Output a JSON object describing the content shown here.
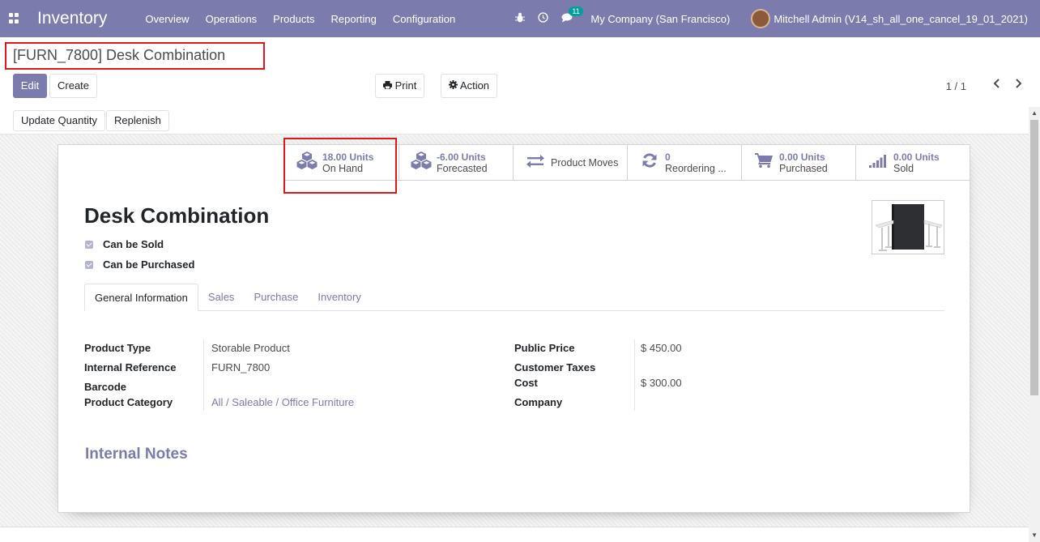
{
  "navbar": {
    "brand": "Inventory",
    "menu": [
      "Overview",
      "Operations",
      "Products",
      "Reporting",
      "Configuration"
    ],
    "chat_count": "11",
    "company": "My Company (San Francisco)",
    "user": "Mitchell Admin (V14_sh_all_one_cancel_19_01_2021)"
  },
  "control_panel": {
    "breadcrumb": "[FURN_7800] Desk Combination",
    "edit_label": "Edit",
    "create_label": "Create",
    "print_label": "Print",
    "action_label": "Action",
    "pager": "1 / 1"
  },
  "statusbar": {
    "update_quantity_label": "Update Quantity",
    "replenish_label": "Replenish"
  },
  "smart_buttons": {
    "on_hand": {
      "value": "18.00 Units",
      "label": "On Hand"
    },
    "forecasted": {
      "value": "-6.00 Units",
      "label": "Forecasted"
    },
    "product_moves": {
      "label": "Product Moves"
    },
    "reordering": {
      "value": "0",
      "label": "Reordering ..."
    },
    "purchased": {
      "value": "0.00 Units",
      "label": "Purchased"
    },
    "sold": {
      "value": "0.00 Units",
      "label": "Sold"
    }
  },
  "product": {
    "name": "Desk Combination",
    "can_be_sold": "Can be Sold",
    "can_be_purchased": "Can be Purchased"
  },
  "tabs": [
    "General Information",
    "Sales",
    "Purchase",
    "Inventory"
  ],
  "fields": {
    "product_type": {
      "label": "Product Type",
      "value": "Storable Product"
    },
    "internal_reference": {
      "label": "Internal Reference",
      "value": "FURN_7800"
    },
    "barcode": {
      "label": "Barcode",
      "value": ""
    },
    "product_category": {
      "label": "Product Category",
      "value": "All / Saleable / Office Furniture"
    },
    "public_price": {
      "label": "Public Price",
      "value": "$ 450.00"
    },
    "customer_taxes": {
      "label": "Customer Taxes",
      "value": ""
    },
    "cost": {
      "label": "Cost",
      "value": "$ 300.00"
    },
    "company": {
      "label": "Company",
      "value": ""
    }
  },
  "internal_notes_title": "Internal Notes",
  "colors": {
    "brand": "#7c7bad",
    "highlight": "#e0181b",
    "badge": "#00a09d"
  }
}
